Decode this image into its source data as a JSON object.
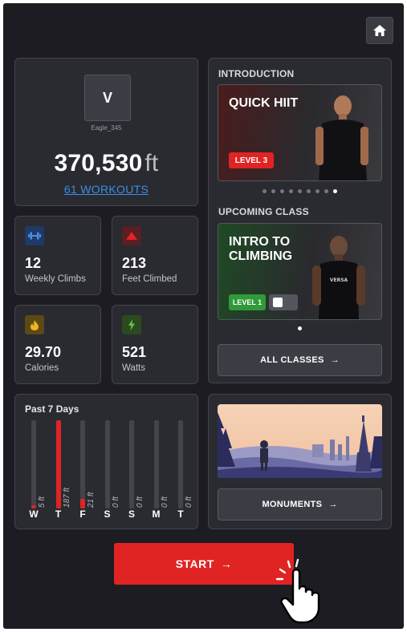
{
  "profile": {
    "avatar_initial": "V",
    "username": "Eagle_345",
    "distance_value": "370,530",
    "distance_unit": "ft",
    "workouts_link": "61 WORKOUTS"
  },
  "stats": [
    {
      "value": "12",
      "label": "Weekly Climbs",
      "icon": "dumbbell-icon",
      "icon_bg": "#1f3a66",
      "icon_color": "#4a90e2"
    },
    {
      "value": "213",
      "label": "Feet Climbed",
      "icon": "mountain-icon",
      "icon_bg": "#5a1f22",
      "icon_color": "#e02424"
    },
    {
      "value": "29.70",
      "label": "Calories",
      "icon": "flame-icon",
      "icon_bg": "#5c4a14",
      "icon_color": "#f0b323"
    },
    {
      "value": "521",
      "label": "Watts",
      "icon": "lightning-icon",
      "icon_bg": "#2c4a20",
      "icon_color": "#6cc04a"
    }
  ],
  "history": {
    "title": "Past 7 Days",
    "days": [
      {
        "day": "W",
        "label": "5 ft",
        "value": 5
      },
      {
        "day": "T",
        "label": "187 ft",
        "value": 187
      },
      {
        "day": "F",
        "label": "21 ft",
        "value": 21
      },
      {
        "day": "S",
        "label": "0 ft",
        "value": 0
      },
      {
        "day": "S",
        "label": "0 ft",
        "value": 0
      },
      {
        "day": "M",
        "label": "0 ft",
        "value": 0
      },
      {
        "day": "T",
        "label": "0 ft",
        "value": 0
      }
    ],
    "max": 187
  },
  "introduction": {
    "section_title": "INTRODUCTION",
    "title": "QUICK HIIT",
    "level": "LEVEL 3",
    "level_color": "#e02424",
    "dots_total": 9,
    "dots_active": 8
  },
  "upcoming": {
    "section_title": "UPCOMING CLASS",
    "title_line1": "INTRO TO",
    "title_line2": "CLIMBING",
    "level": "LEVEL 1",
    "level_color": "#2f9a3a",
    "dots_total": 1,
    "dots_active": 0
  },
  "all_classes_label": "ALL CLASSES",
  "monuments_label": "MONUMENTS",
  "start_label": "START",
  "colors": {
    "accent": "#e02424",
    "background": "#1c1c22",
    "card": "#2a2a31",
    "link": "#3a8ee6"
  }
}
